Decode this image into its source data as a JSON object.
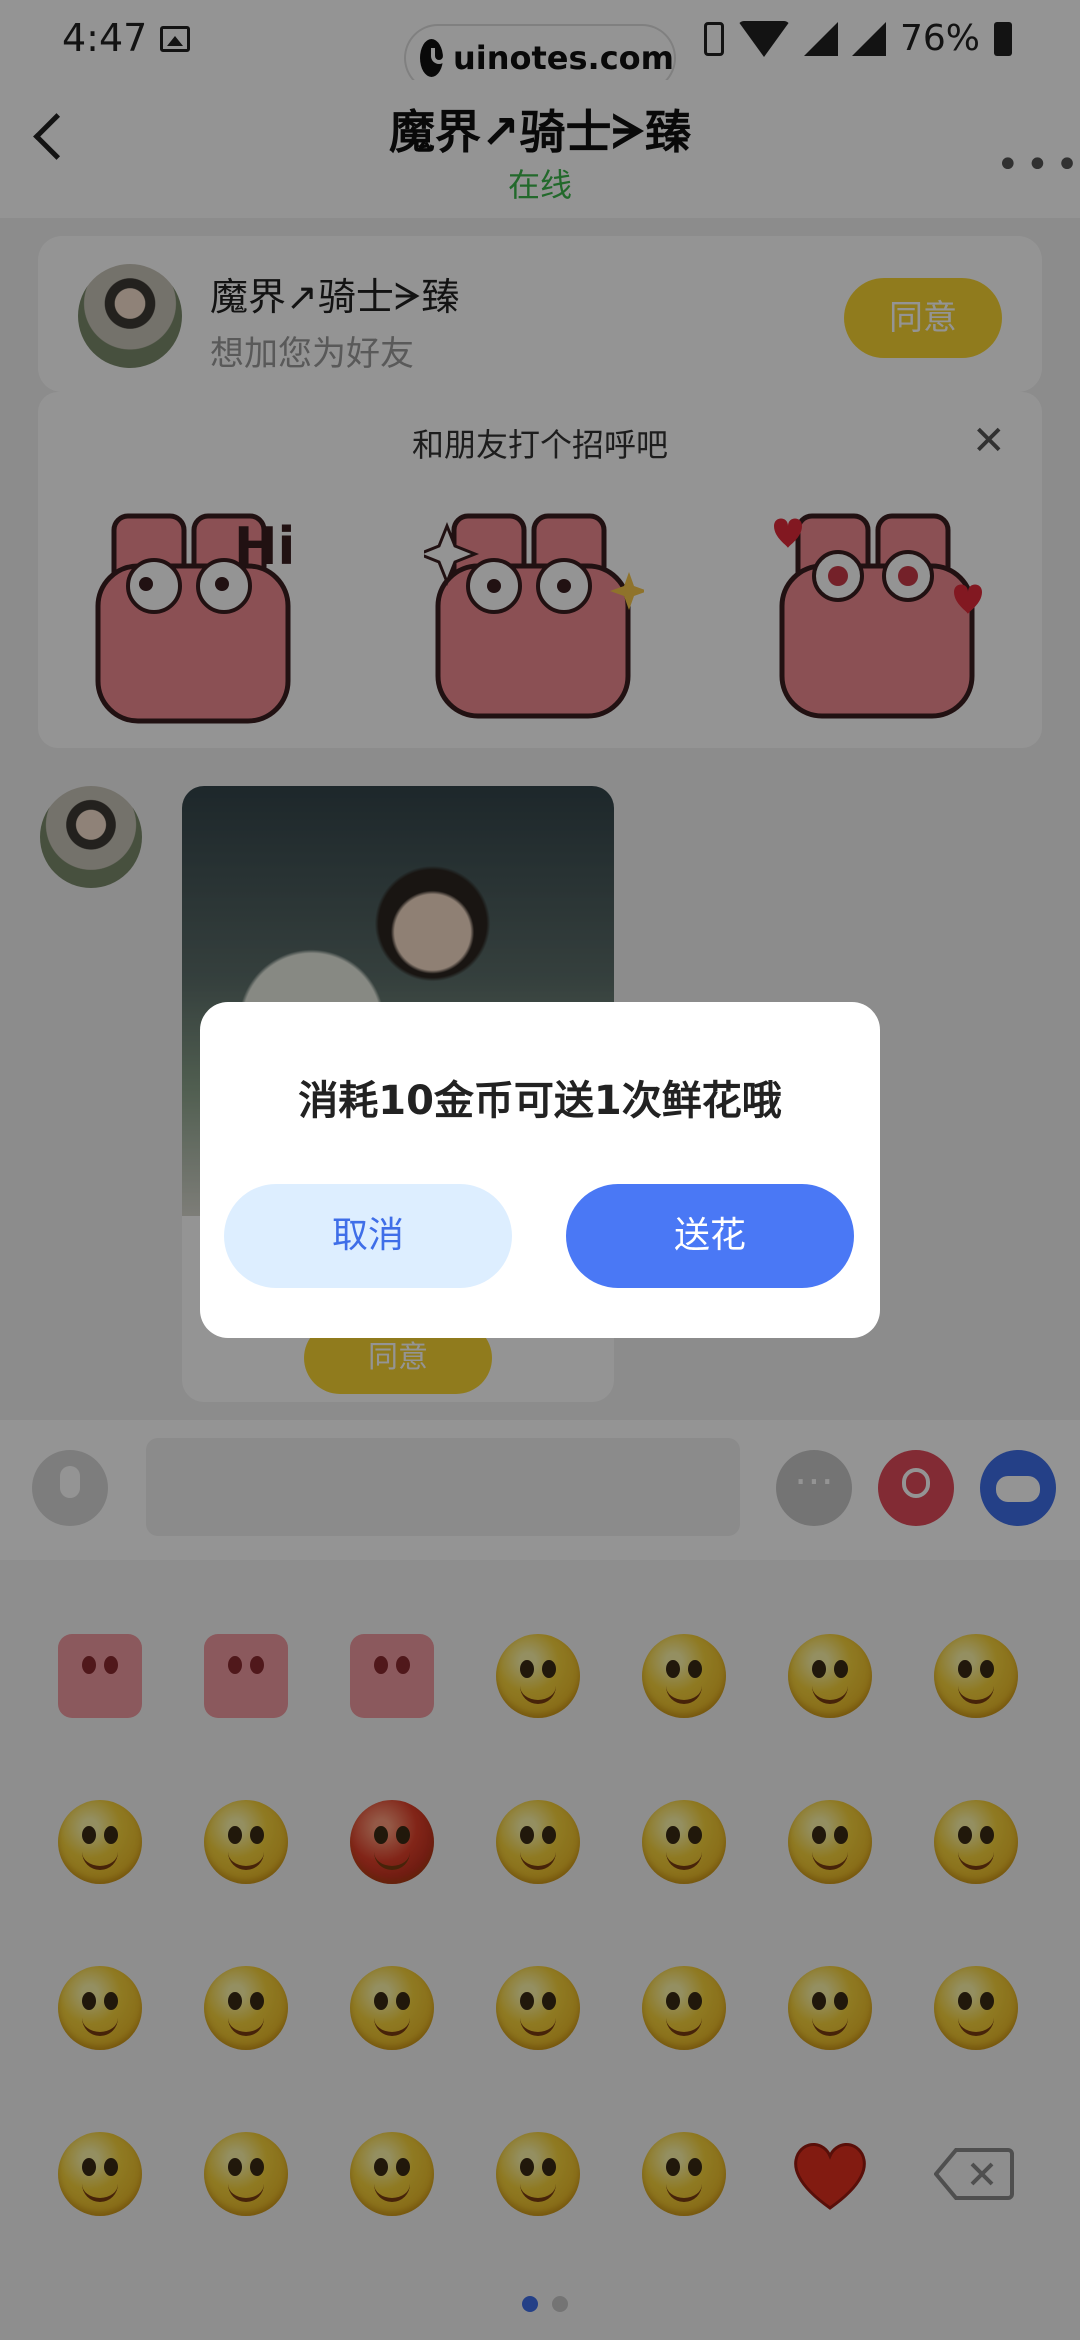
{
  "status": {
    "time": "4:47",
    "battery": "76%",
    "watermark": "uinotes.com"
  },
  "header": {
    "title": "魔界↗骑士ᗒ臻",
    "subtitle": "在线"
  },
  "friend_request": {
    "name": "魔界↗骑士ᗒ臻",
    "description": "想加您为好友",
    "agree_label": "同意"
  },
  "greeting": {
    "title": "和朋友打个招呼吧",
    "close": "✕",
    "stickers": [
      "hi-sticker",
      "thumbs-up-sticker",
      "shy-heart-sticker"
    ]
  },
  "chat": {
    "bubble_agree_label": "同意"
  },
  "dialog": {
    "message": "消耗10金币可送1次鲜花哦",
    "cancel_label": "取消",
    "send_label": "送花"
  },
  "colors": {
    "accent_blue": "#4a78f5",
    "agree_yellow": "#f8d532",
    "online_green": "#3bb54a",
    "flower_red": "#e04a5a"
  },
  "emoji_panel": {
    "page_count": 2,
    "active_page": 1
  }
}
